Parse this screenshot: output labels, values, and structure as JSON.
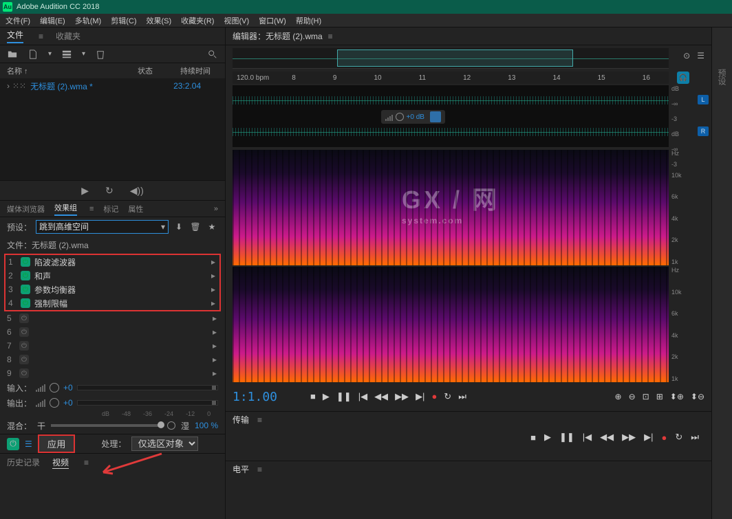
{
  "app": {
    "title": "Adobe Audition CC 2018"
  },
  "menubar": [
    "文件(F)",
    "编辑(E)",
    "多轨(M)",
    "剪辑(C)",
    "效果(S)",
    "收藏夹(R)",
    "视图(V)",
    "窗口(W)",
    "帮助(H)"
  ],
  "left": {
    "tabs": {
      "files": "文件",
      "fav": "收藏夹"
    },
    "columns": {
      "name": "名称 ↑",
      "status": "状态",
      "duration": "持续时间"
    },
    "file": {
      "name": "无标题 (2).wma *",
      "duration": "23:2.04"
    },
    "media_tabs": {
      "browser": "媒体浏览器",
      "rack": "效果组",
      "marker": "标记",
      "props": "属性"
    },
    "preset": {
      "label": "预设：",
      "value": "跳到高维空间"
    },
    "file_label": "文件：无标题 (2).wma",
    "effects": [
      {
        "n": "1",
        "name": "陷波滤波器",
        "on": true
      },
      {
        "n": "2",
        "name": "和声",
        "on": true
      },
      {
        "n": "3",
        "name": "参数均衡器",
        "on": true
      },
      {
        "n": "4",
        "name": "强制限幅",
        "on": true
      }
    ],
    "empty_slots": [
      "5",
      "6",
      "7",
      "8",
      "9"
    ],
    "io": {
      "in_label": "输入：",
      "out_label": "输出：",
      "val": "+0"
    },
    "db_ticks": [
      "dB",
      "-48",
      "-36",
      "-24",
      "-12",
      "0"
    ],
    "mix": {
      "label": "混合：",
      "dry": "干",
      "wet": "湿",
      "pct": "100 %"
    },
    "apply": {
      "btn": "应用",
      "proc_label": "处理：",
      "proc_value": "仅选区对象"
    },
    "history": {
      "hist": "历史记录",
      "video": "视频"
    }
  },
  "editor": {
    "title": "编辑器：无标题 (2).wma",
    "bpm": "120.0 bpm",
    "ticks": [
      "8",
      "9",
      "10",
      "11",
      "12",
      "13",
      "14",
      "15",
      "16"
    ],
    "db_label": "dB",
    "db_vals": [
      "-∞",
      "-3"
    ],
    "gain": "+0 dB",
    "hz": "Hz",
    "freq_ticks": [
      "10k",
      "6k",
      "4k",
      "2k",
      "1k"
    ],
    "ch_l": "L",
    "ch_r": "R",
    "timecode": "1:1.00",
    "sub_tabs": {
      "transport": "传输",
      "level": "电平"
    }
  },
  "far_right": {
    "preset": "预设"
  },
  "watermark": {
    "big": "GX / 网",
    "small": "system.com"
  }
}
